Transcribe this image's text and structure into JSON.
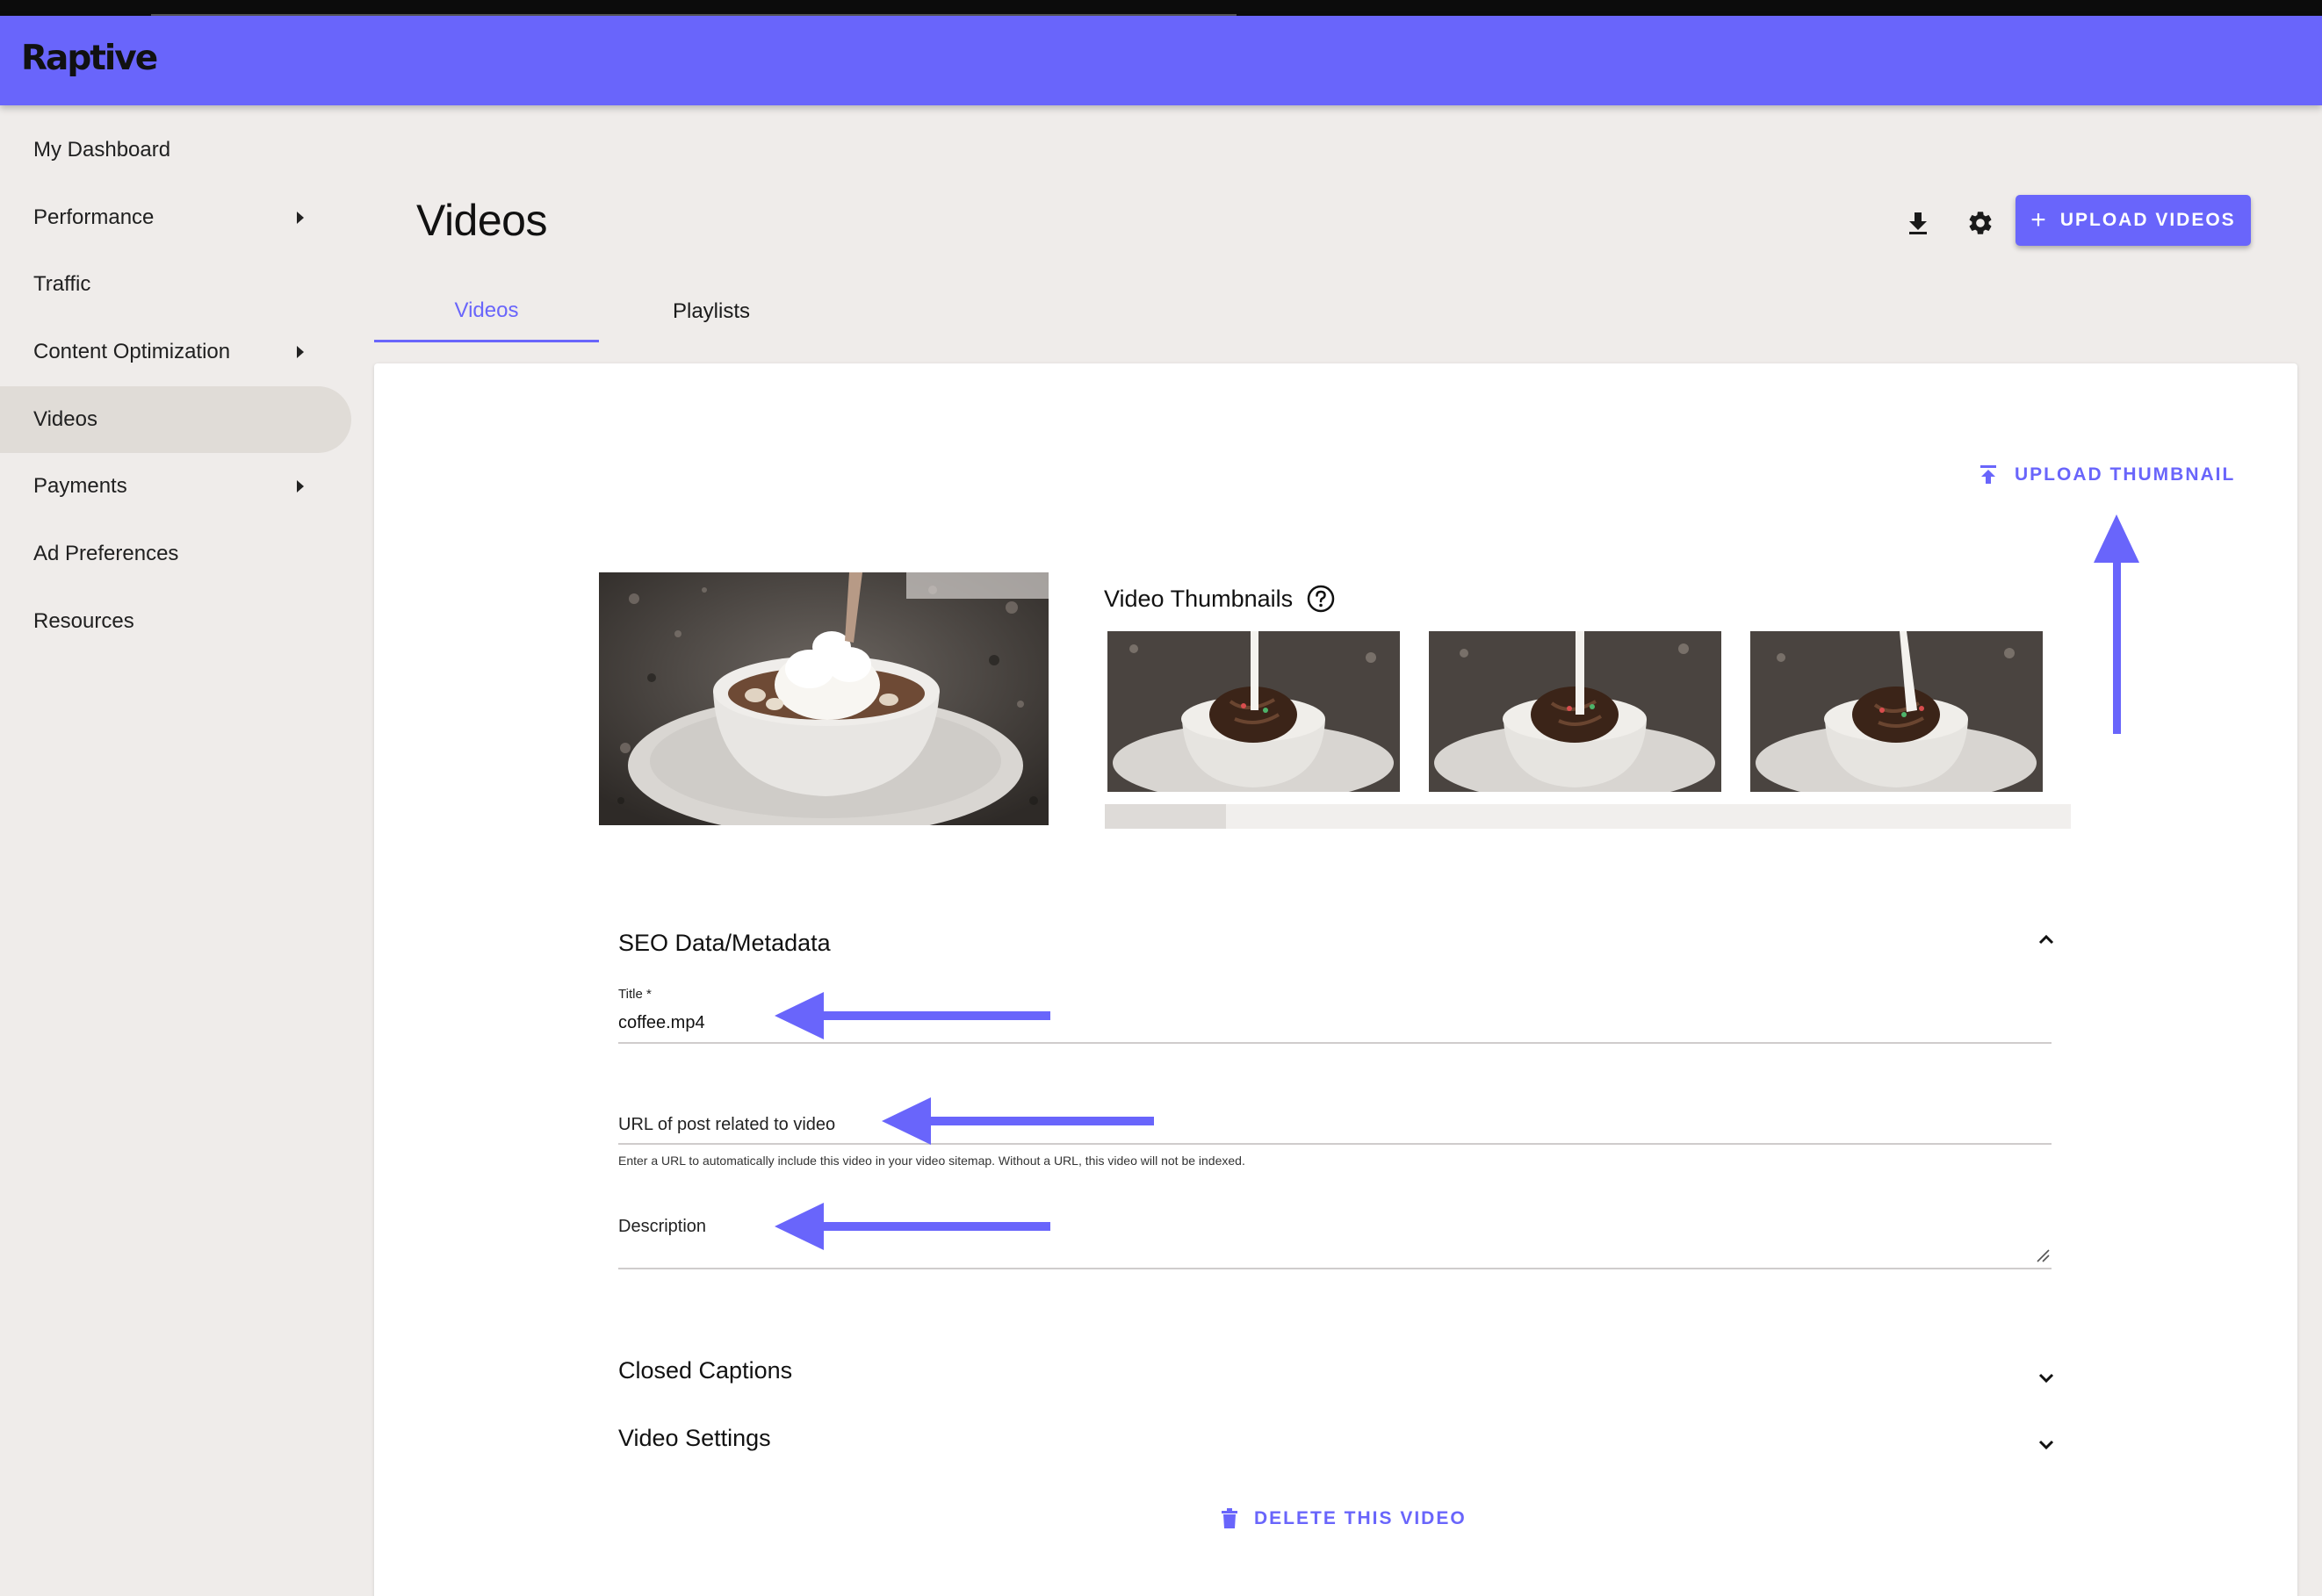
{
  "header": {
    "logo_text": "Raptive"
  },
  "sidebar": {
    "items": [
      {
        "label": "My Dashboard",
        "has_submenu": false,
        "active": false
      },
      {
        "label": "Performance",
        "has_submenu": true,
        "active": false
      },
      {
        "label": "Traffic",
        "has_submenu": false,
        "active": false
      },
      {
        "label": "Content Optimization",
        "has_submenu": true,
        "active": false
      },
      {
        "label": "Videos",
        "has_submenu": false,
        "active": true
      },
      {
        "label": "Payments",
        "has_submenu": true,
        "active": false
      },
      {
        "label": "Ad Preferences",
        "has_submenu": false,
        "active": false
      },
      {
        "label": "Resources",
        "has_submenu": false,
        "active": false
      }
    ]
  },
  "page": {
    "title": "Videos",
    "toolbar": {
      "upload_videos_label": "UPLOAD VIDEOS",
      "download_icon": "download-icon",
      "settings_icon": "gear-icon"
    },
    "tabs": [
      {
        "label": "Videos",
        "active": true
      },
      {
        "label": "Playlists",
        "active": false
      }
    ]
  },
  "video": {
    "upload_thumbnail_label": "UPLOAD THUMBNAIL",
    "thumbnails_label": "Video Thumbnails",
    "thumbnail_count": 3
  },
  "seo": {
    "section_title": "SEO Data/Metadata",
    "expanded": true,
    "title_label": "Title *",
    "title_value": "coffee.mp4",
    "url_placeholder": "URL of post related to video",
    "url_helper": "Enter a URL to automatically include this video in your video sitemap. Without a URL, this video will not be indexed.",
    "description_placeholder": "Description"
  },
  "sections": {
    "closed_captions": "Closed Captions",
    "video_settings": "Video Settings"
  },
  "actions": {
    "delete_label": "DELETE THIS VIDEO"
  },
  "colors": {
    "accent": "#6965fb",
    "background": "#efecea",
    "card": "#ffffff",
    "active_nav": "#e0dcd7"
  }
}
